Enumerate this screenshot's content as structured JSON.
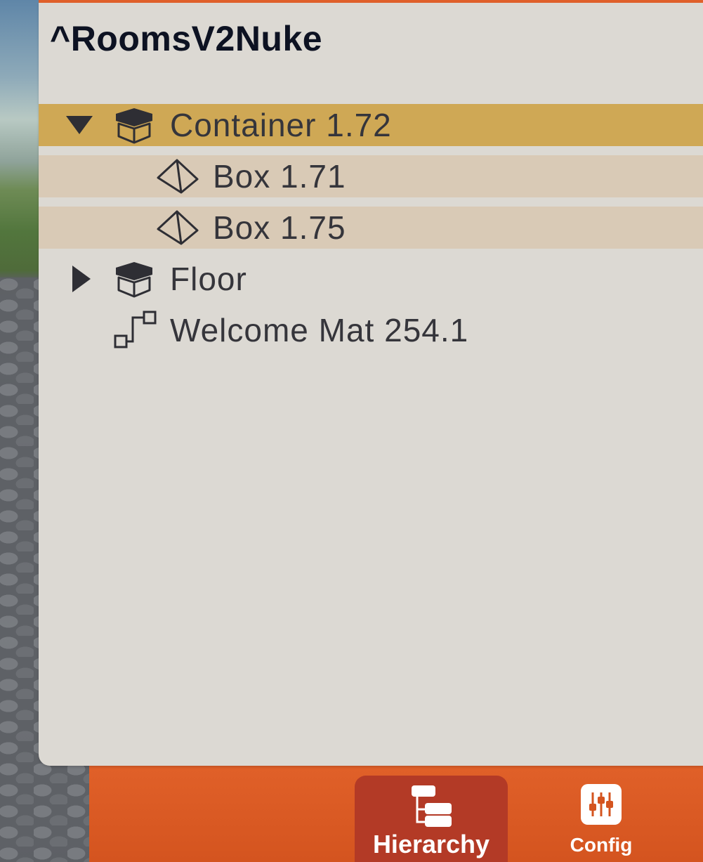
{
  "panel": {
    "title": "^RoomsV2Nuke"
  },
  "hierarchy": {
    "items": [
      {
        "label": "Container 1.72",
        "kind": "container",
        "expanded": true,
        "selected": true,
        "depth": 0
      },
      {
        "label": "Box 1.71",
        "kind": "mesh",
        "depth": 1
      },
      {
        "label": "Box 1.75",
        "kind": "mesh",
        "depth": 1
      },
      {
        "label": "Floor",
        "kind": "container",
        "expanded": false,
        "depth": 0
      },
      {
        "label": "Welcome Mat 254.1",
        "kind": "link",
        "depth": 0
      }
    ]
  },
  "nav": {
    "tabs": [
      {
        "label": "Hierarchy",
        "icon": "hierarchy-icon",
        "active": true
      },
      {
        "label": "Config",
        "icon": "sliders-icon",
        "active": false
      }
    ]
  },
  "colors": {
    "accent": "#e0602a",
    "selected_row": "#cfa855",
    "child_row": "#d9cab6",
    "panel": "#dcd9d3",
    "active_tab": "#b33a26"
  }
}
